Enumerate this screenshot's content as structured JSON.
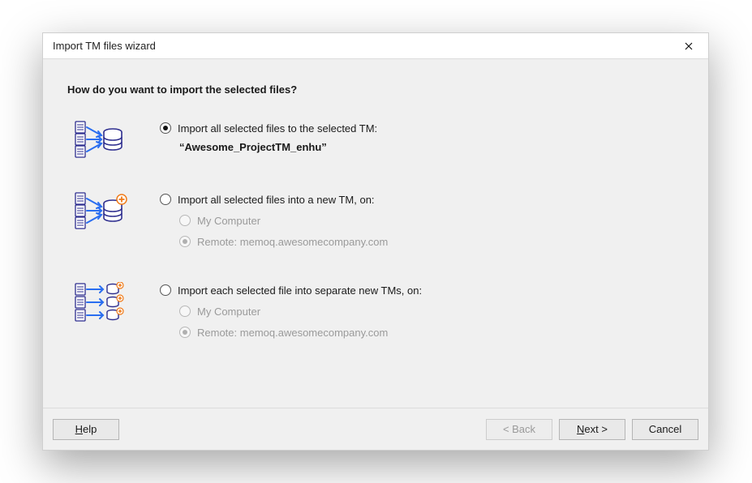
{
  "titlebar": {
    "title": "Import TM files wizard"
  },
  "question": "How do you want to import the selected files?",
  "opt1": {
    "label": "Import all selected files to the selected TM:",
    "tm_name": "“Awesome_ProjectTM_enhu”"
  },
  "opt2": {
    "label": "Import all selected files into a new TM, on:",
    "local_label": "My Computer",
    "remote_label": "Remote:",
    "remote_host": "memoq.awesomecompany.com"
  },
  "opt3": {
    "label": "Import each selected file into separate new TMs, on:",
    "local_label": "My Computer",
    "remote_label": "Remote:",
    "remote_host": "memoq.awesomecompany.com"
  },
  "footer": {
    "help": "Help",
    "back": "< Back",
    "next": "Next >",
    "cancel": "Cancel"
  }
}
